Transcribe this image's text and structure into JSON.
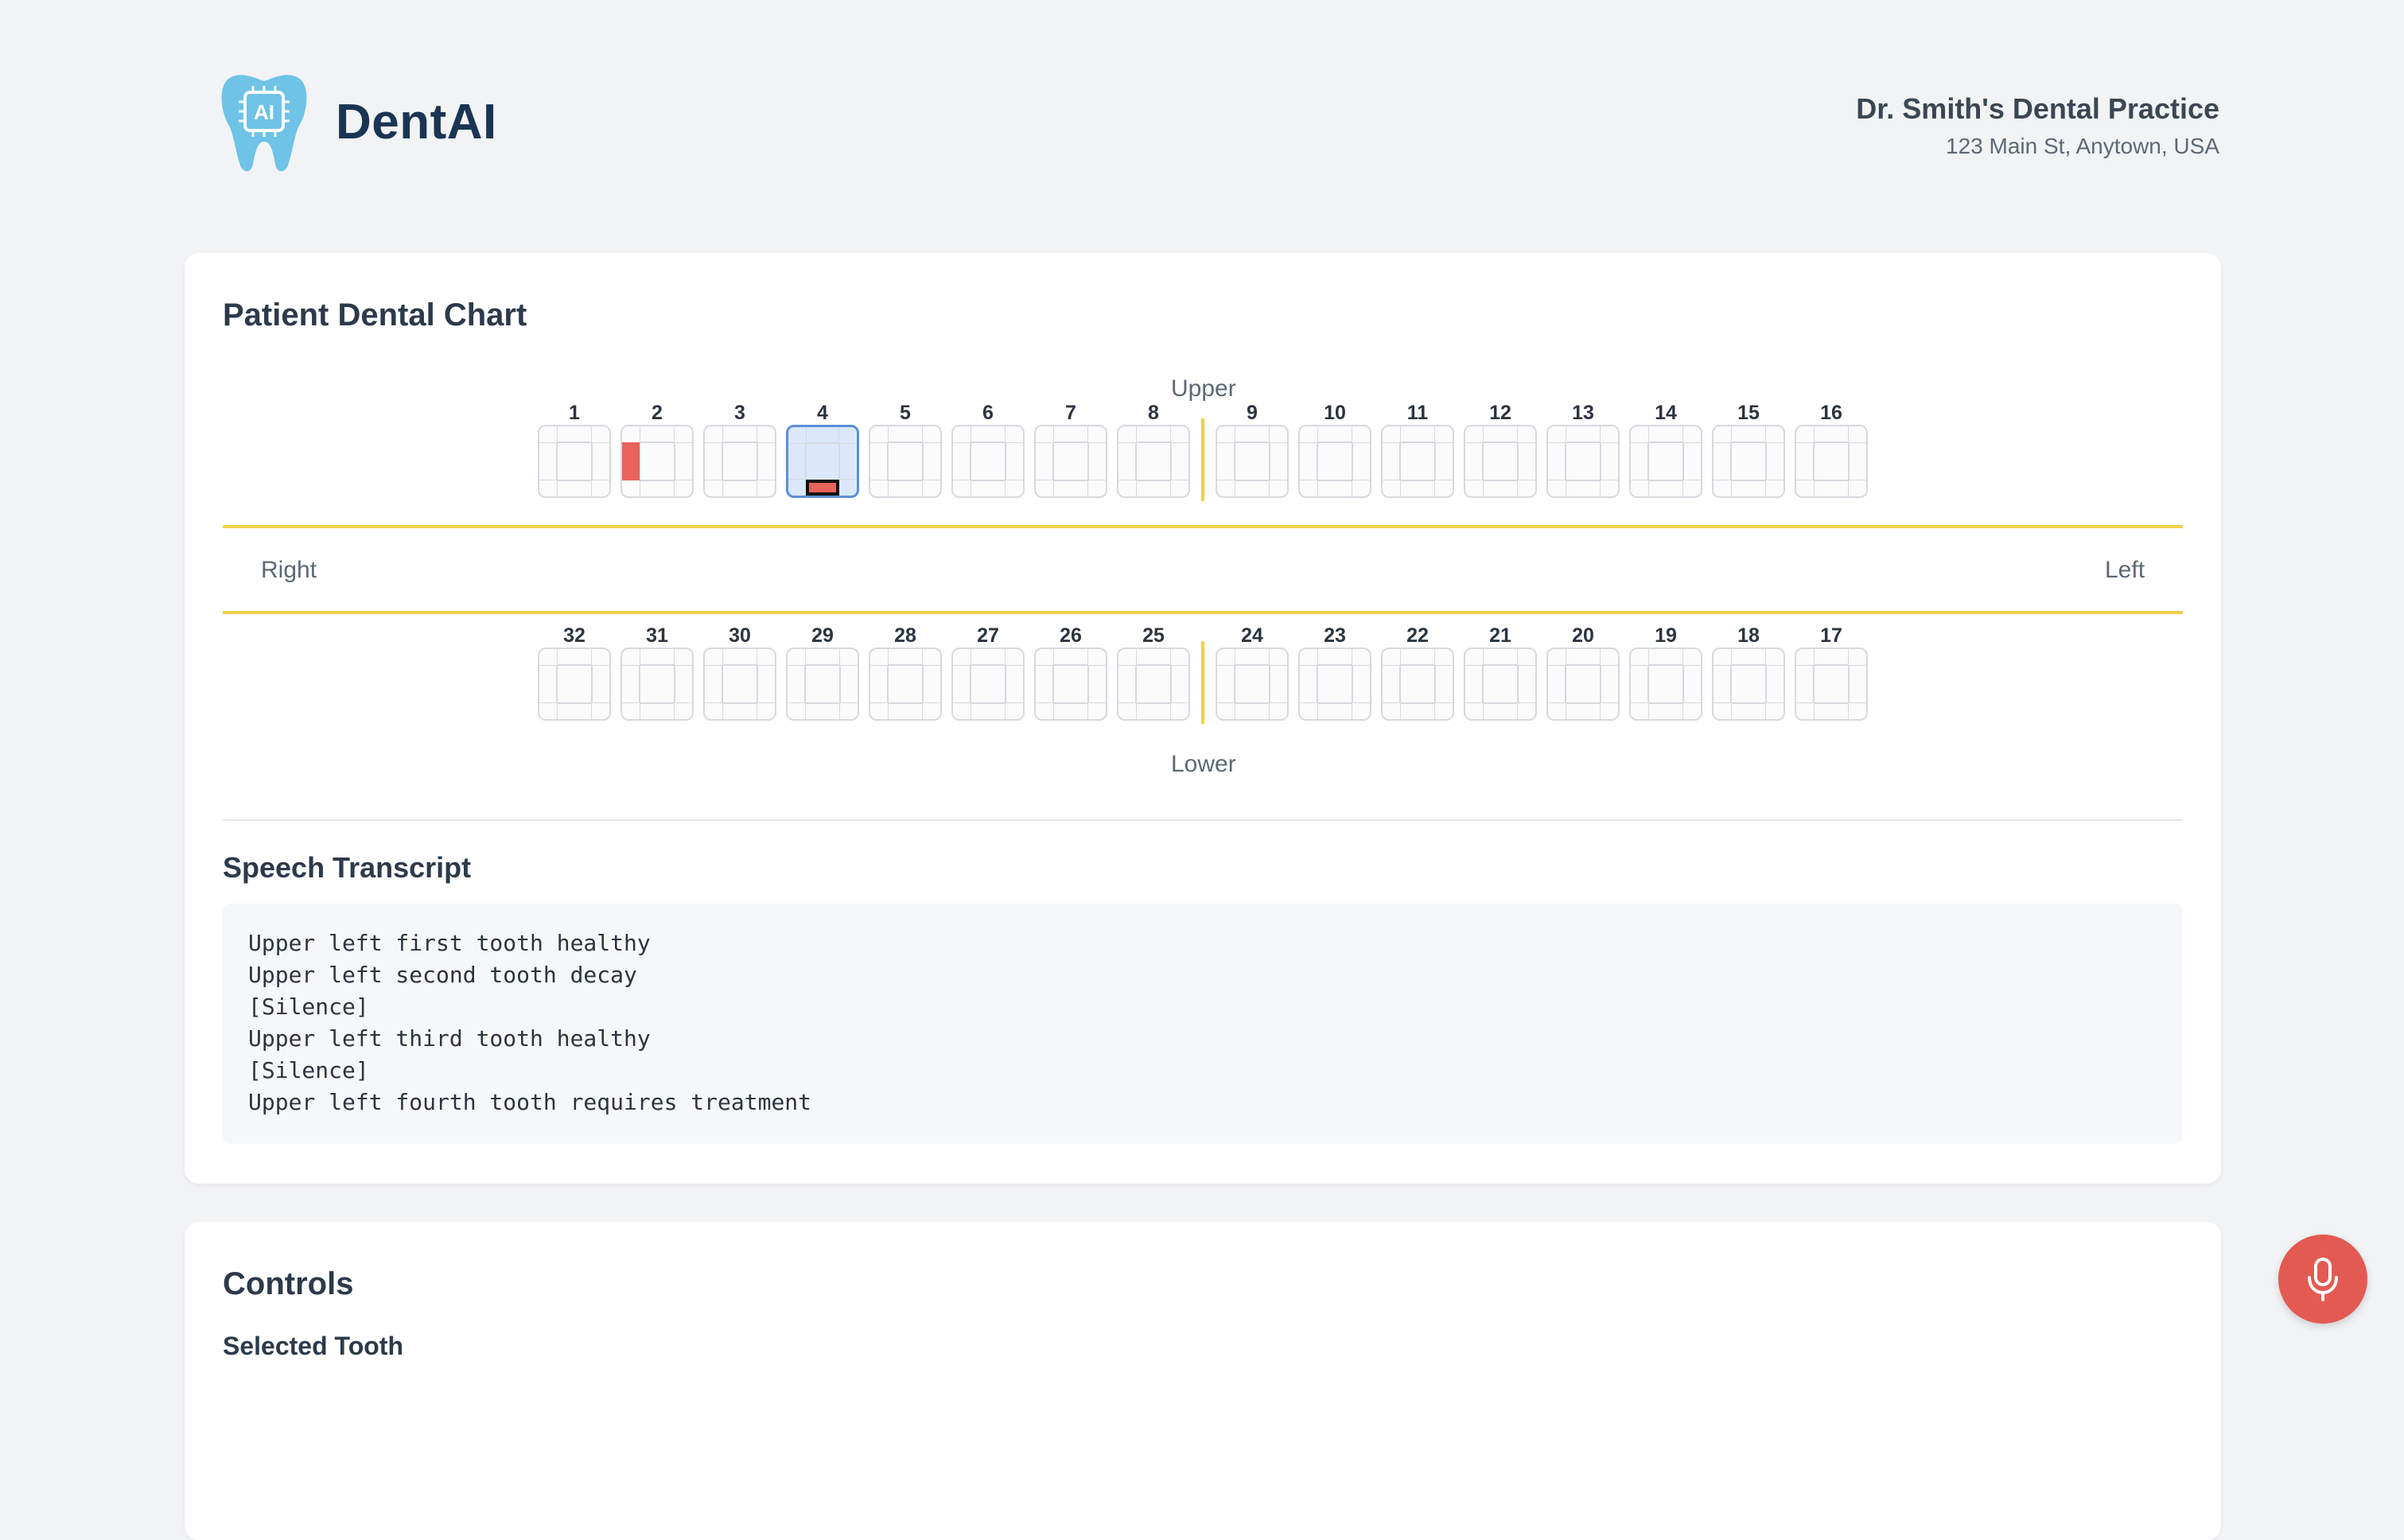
{
  "header": {
    "brand": "DentAI",
    "logo_text": "AI",
    "practice_name": "Dr. Smith's Dental Practice",
    "practice_address": "123 Main St, Anytown, USA"
  },
  "chart": {
    "title": "Patient Dental Chart",
    "upper_label": "Upper",
    "lower_label": "Lower",
    "right_label": "Right",
    "left_label": "Left",
    "upper_teeth": [
      "1",
      "2",
      "3",
      "4",
      "5",
      "6",
      "7",
      "8",
      "9",
      "10",
      "11",
      "12",
      "13",
      "14",
      "15",
      "16"
    ],
    "lower_teeth": [
      "32",
      "31",
      "30",
      "29",
      "28",
      "27",
      "26",
      "25",
      "24",
      "23",
      "22",
      "21",
      "20",
      "19",
      "18",
      "17"
    ],
    "selected_tooth": "4",
    "conditions": [
      {
        "tooth": "2",
        "surface": "left",
        "status": "decay"
      },
      {
        "tooth": "4",
        "surface": "bottom",
        "status": "treatment"
      }
    ],
    "colors": {
      "decay": "#e8635a",
      "selected": "#dbe8fb",
      "midline": "#f2cf4a"
    }
  },
  "transcript": {
    "title": "Speech Transcript",
    "lines": [
      "Upper left first tooth healthy",
      "Upper left second tooth decay",
      "[Silence]",
      "Upper left third tooth healthy",
      "[Silence]",
      "Upper left fourth tooth requires treatment"
    ]
  },
  "controls": {
    "title": "Controls",
    "selected_tooth_label": "Selected Tooth"
  },
  "mic": {
    "icon": "microphone-icon"
  }
}
